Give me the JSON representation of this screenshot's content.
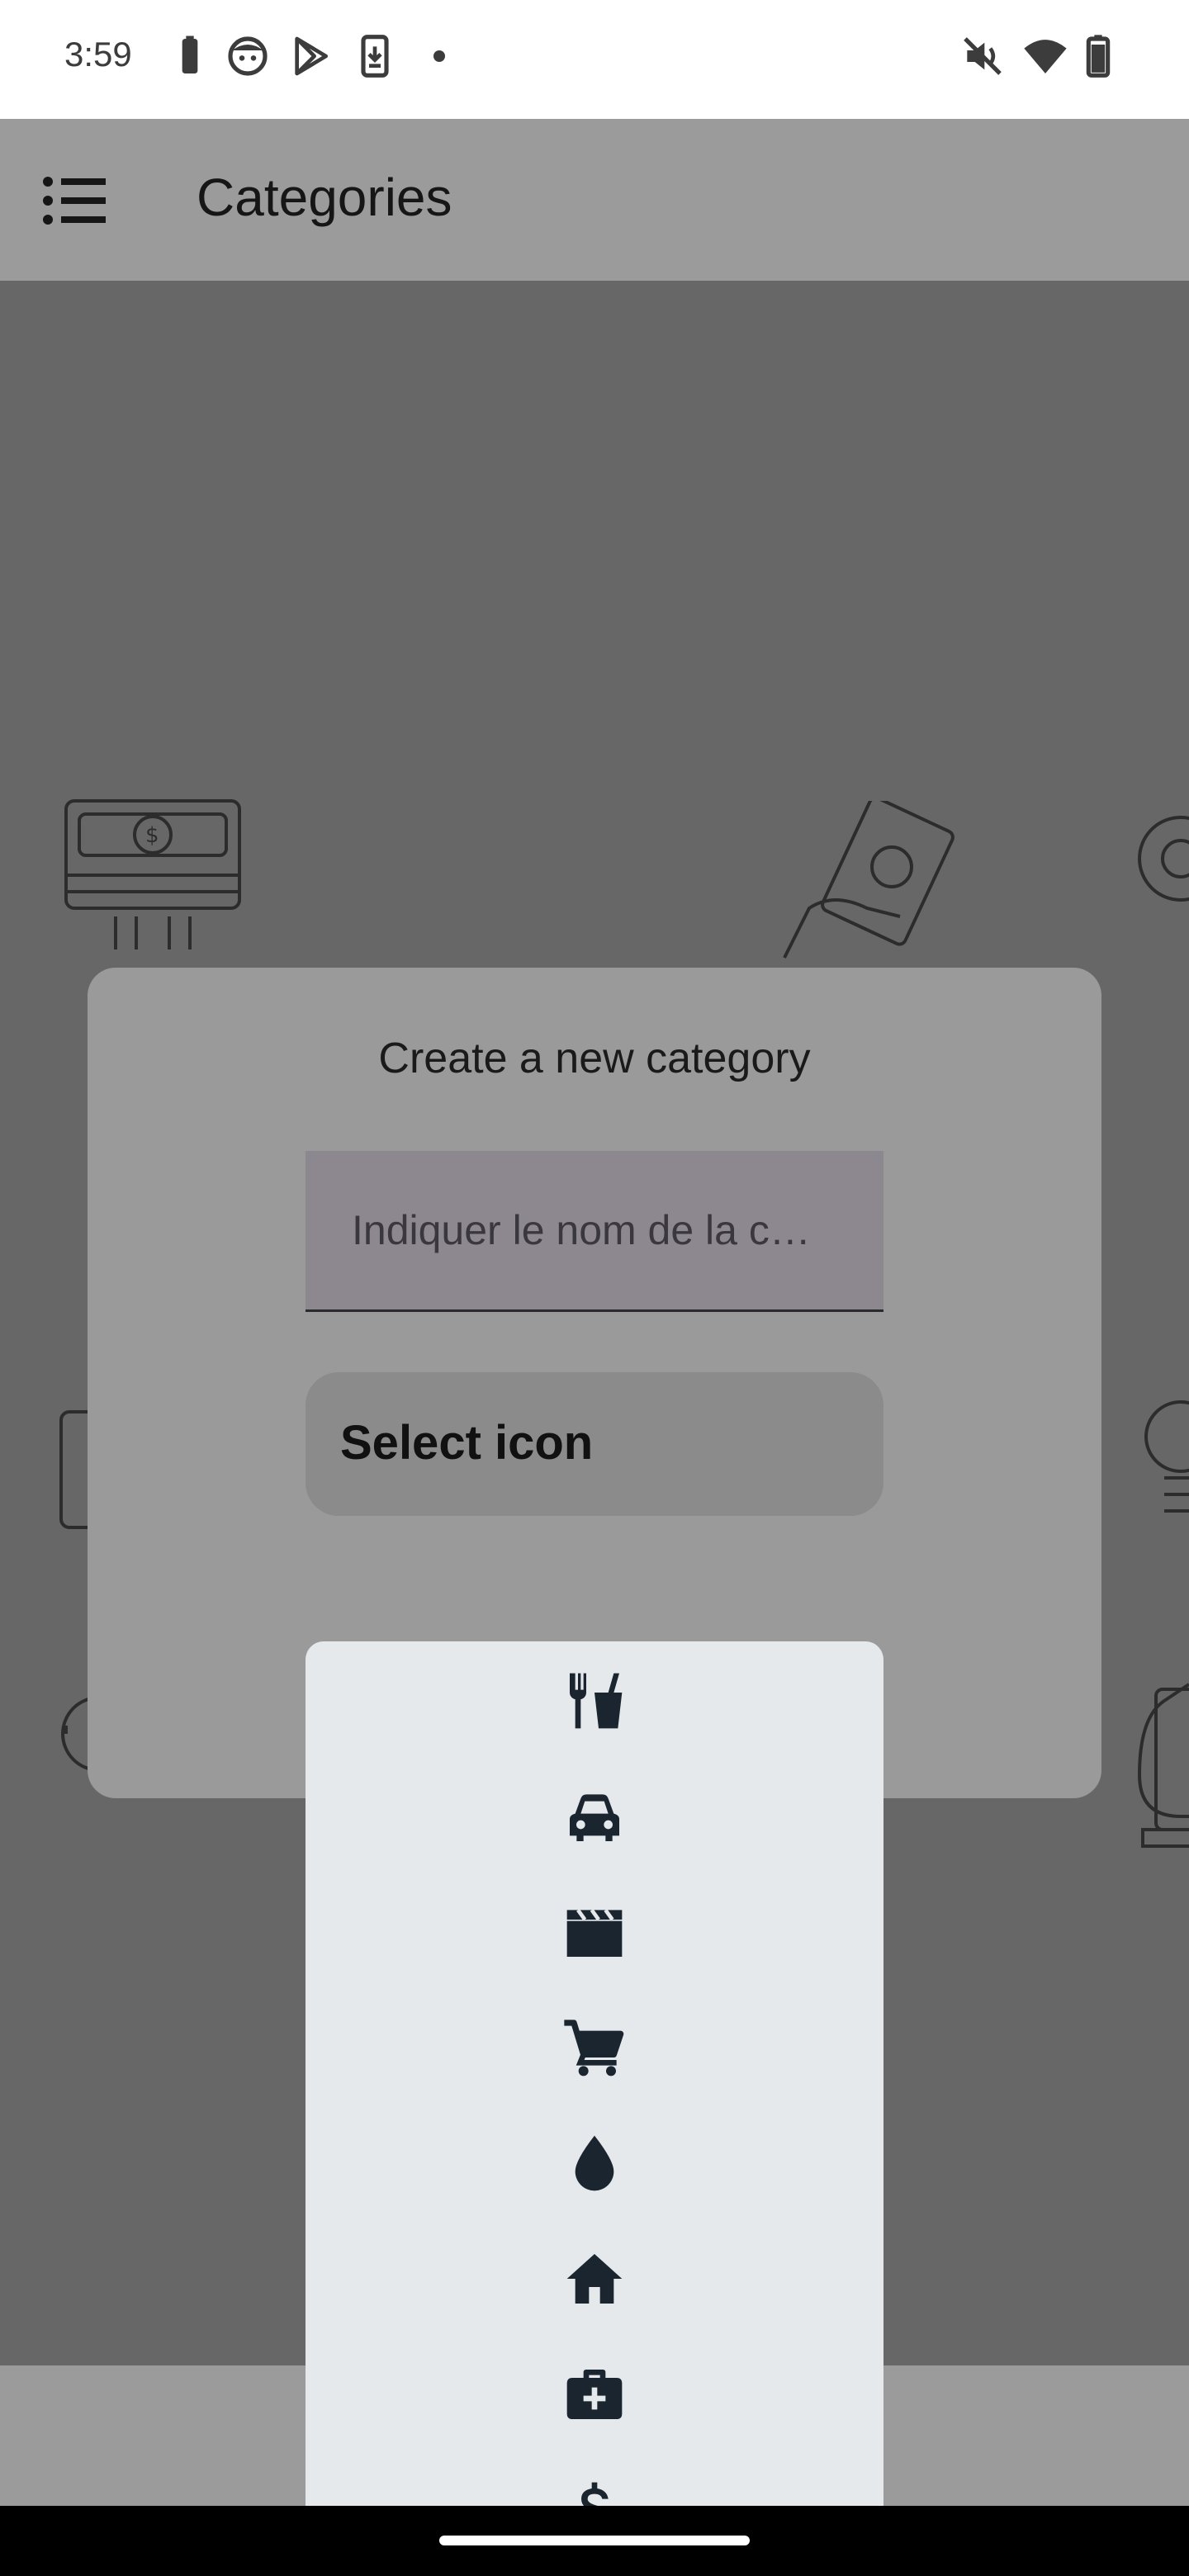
{
  "status_bar": {
    "time": "3:59"
  },
  "app_bar": {
    "title": "Categories"
  },
  "dialog": {
    "title": "Create a new category",
    "name_placeholder": "Indiquer le nom de la c…",
    "select_icon_label": "Select icon"
  },
  "icon_menu": {
    "items": [
      "restaurant-icon",
      "car-icon",
      "movie-icon",
      "shopping-cart-icon",
      "water-drop-icon",
      "home-icon",
      "medical-bag-icon",
      "dollar-icon"
    ]
  },
  "colors": {
    "scrim": "#676767",
    "app_bar": "#9b9b9b",
    "dialog": "#9a9a9a",
    "menu": "#e6e9ec",
    "icon": "#1b2530"
  }
}
